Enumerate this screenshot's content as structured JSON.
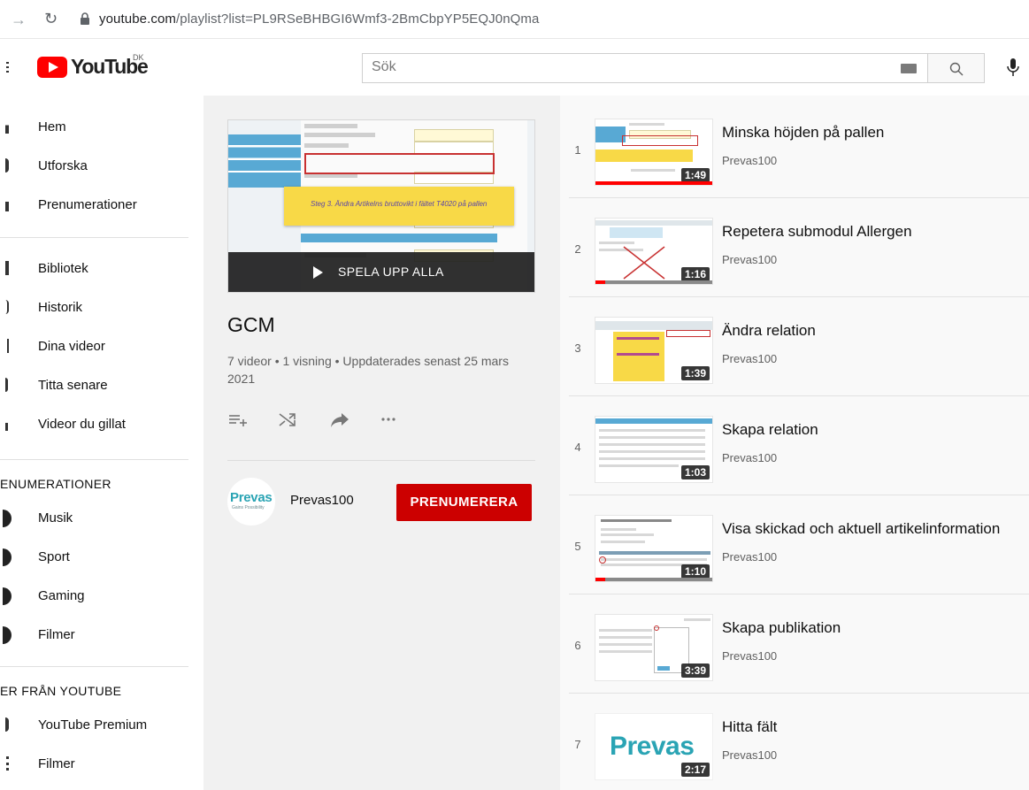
{
  "browser": {
    "url_host": "youtube.com",
    "url_path": "/playlist?list=PL9RSeBHBGI6Wmf3-2BmCbpYP5EQJ0nQma"
  },
  "header": {
    "logo_text": "YouTube",
    "country_code": "DK",
    "search_placeholder": "Sök"
  },
  "sidebar": {
    "main_items": [
      "Hem",
      "Utforska",
      "Prenumerationer"
    ],
    "library_items": [
      "Bibliotek",
      "Historik",
      "Dina videor",
      "Titta senare",
      "Videor du gillat"
    ],
    "subscriptions_title": "ENUMERATIONER",
    "subscriptions": [
      "Musik",
      "Sport",
      "Gaming",
      "Filmer"
    ],
    "more_title": "ER FRÅN YOUTUBE",
    "more_items": [
      "YouTube Premium",
      "Filmer"
    ]
  },
  "playlist": {
    "play_all_label": "SPELA UPP ALLA",
    "thumb_note": "Steg 3. Ändra Artikelns bruttovikt i fältet T4020 på pallen",
    "title": "GCM",
    "meta": "7 videor • 1 visning • Uppdaterades senast 25 mars 2021",
    "owner_logo_text": "Prevas",
    "owner_logo_sub": "Gains Possibility",
    "owner_name": "Prevas100",
    "subscribe_label": "PRENUMERERA"
  },
  "videos": [
    {
      "index": "1",
      "title": "Minska höjden på pallen",
      "channel": "Prevas100",
      "duration": "1:49",
      "watched_fraction": 1.0
    },
    {
      "index": "2",
      "title": "Repetera submodul Allergen",
      "channel": "Prevas100",
      "duration": "1:16",
      "watched_fraction": 0.08
    },
    {
      "index": "3",
      "title": "Ändra relation",
      "channel": "Prevas100",
      "duration": "1:39",
      "watched_fraction": 0
    },
    {
      "index": "4",
      "title": "Skapa relation",
      "channel": "Prevas100",
      "duration": "1:03",
      "watched_fraction": 0
    },
    {
      "index": "5",
      "title": "Visa skickad och aktuell artikelinformation",
      "channel": "Prevas100",
      "duration": "1:10",
      "watched_fraction": 0.08
    },
    {
      "index": "6",
      "title": "Skapa publikation",
      "channel": "Prevas100",
      "duration": "3:39",
      "watched_fraction": 0
    },
    {
      "index": "7",
      "title": "Hitta fält",
      "channel": "Prevas100",
      "duration": "2:17",
      "watched_fraction": 0
    }
  ],
  "thumb7_text": "Prevas",
  "colors": {
    "brand_red": "#ff0000",
    "subscribe_red": "#cc0000",
    "prevas_teal": "#2aa4b4"
  }
}
